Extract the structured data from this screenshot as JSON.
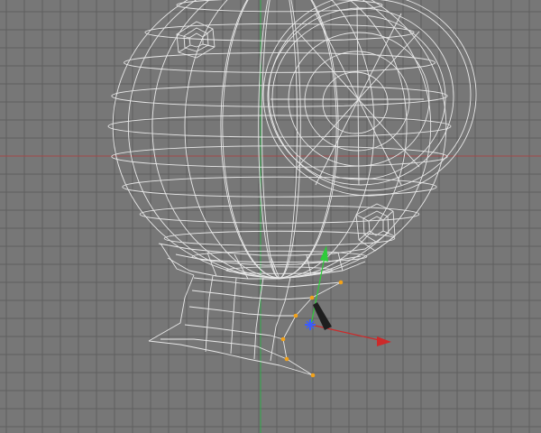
{
  "viewport": {
    "background": "#777777",
    "grid_color": "#5f5f5f",
    "wire_color": "#e8e8e8",
    "horizon_axis_color": "#a34a4a",
    "vertical_axis_color": "#2fa84a",
    "selected_vertex_color": "#f2a21a"
  },
  "gizmo": {
    "x_handle_color": "#cc2a2a",
    "y_handle_color": "#2ecc3a",
    "pivot_color": "#3a5cff",
    "z_handle_color": "#1e1e1e"
  },
  "icons": [
    "move-gizmo-icon",
    "pivot-icon"
  ]
}
